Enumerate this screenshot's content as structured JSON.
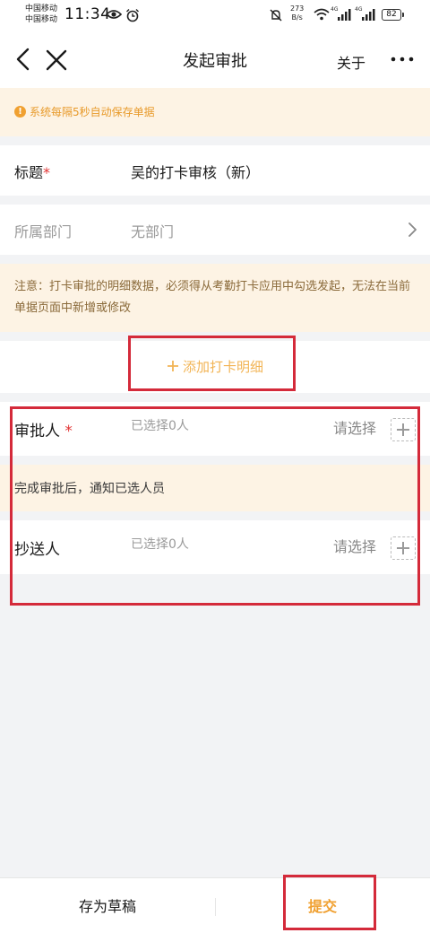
{
  "status_bar": {
    "carrier_1": "中国移动",
    "carrier_2": "中国移动",
    "time": "11:34",
    "net_speed_value": "273",
    "net_speed_unit": "B/s",
    "signal_1": "4G",
    "signal_2": "4G",
    "battery": "82",
    "icons": [
      "eye-icon",
      "alarm-icon",
      "mute-bell-icon",
      "wifi-icon",
      "signal-icon",
      "signal-icon",
      "battery-icon"
    ]
  },
  "navbar": {
    "title": "发起审批",
    "about": "关于",
    "icons": [
      "back-icon",
      "close-icon",
      "more-icon"
    ]
  },
  "autosave_notice": "系统每隔5秒自动保存单据",
  "form": {
    "title_label": "标题",
    "required_mark": "*",
    "title_value": "吴的打卡审核（新）",
    "dept_label": "所属部门",
    "dept_value": "无部门"
  },
  "note": "注意：打卡审批的明细数据，必须得从考勤打卡应用中勾选发起，无法在当前单据页面中新增或修改",
  "add_detail": "添加打卡明细",
  "approver": {
    "label": "审批人",
    "required_mark": "*",
    "count": "已选择0人",
    "choose": "请选择"
  },
  "notify": "完成审批后，通知已选人员",
  "cc": {
    "label": "抄送人",
    "count": "已选择0人",
    "choose": "请选择"
  },
  "bottom": {
    "draft": "存为草稿",
    "submit": "提交"
  },
  "colors": {
    "accent": "#f0a030",
    "highlight_border": "#d42a3a",
    "notice_bg": "#fdf3e4",
    "required": "#e23434"
  }
}
